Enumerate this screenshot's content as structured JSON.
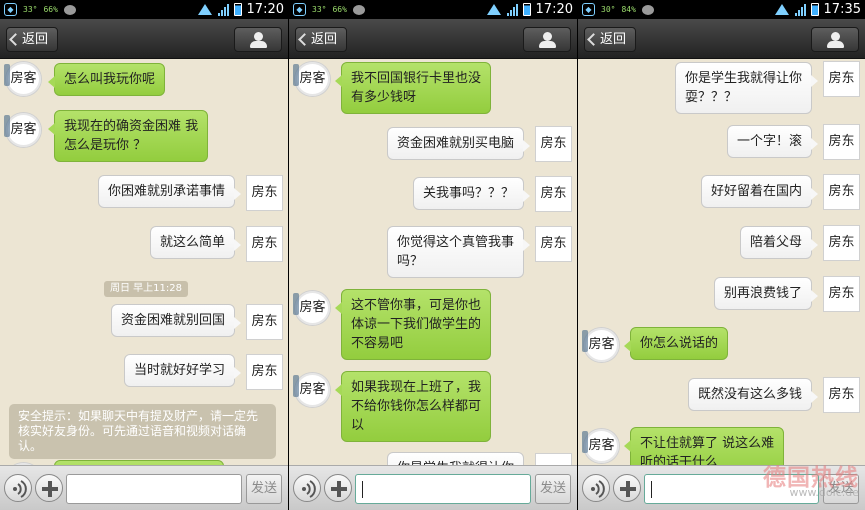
{
  "common": {
    "back_label": "返回",
    "guest_name": "房客",
    "host_name": "房东",
    "send_label": "发送"
  },
  "panels": [
    {
      "status": {
        "time": "17:20",
        "left_a": "33°",
        "left_b": "66%"
      },
      "messages": [
        {
          "side": "left",
          "text": "怎么叫我玩你呢"
        },
        {
          "side": "left",
          "text": "我现在的确资金困难 我\n怎么是玩你 ？"
        },
        {
          "side": "right",
          "text": "你困难就别承诺事情"
        },
        {
          "side": "right",
          "text": "就这么简单"
        },
        {
          "side": "time",
          "text": "周日 早上11:28"
        },
        {
          "side": "right",
          "text": "资金困难就别回国"
        },
        {
          "side": "right",
          "text": "当时就好好学习"
        },
        {
          "side": "notice",
          "text": "安全提示：如果聊天中有提及财产，请一定先核实好友身份。可先通过语音和视频对话确认。"
        }
      ]
    },
    {
      "status": {
        "time": "17:20",
        "left_a": "33°",
        "left_b": "66%"
      },
      "messages": [
        {
          "side": "left",
          "text": "我不回国银行卡里也没\n有多少钱呀"
        },
        {
          "side": "right",
          "text": "资金困难就别买电脑"
        },
        {
          "side": "right",
          "text": "关我事吗？？？"
        },
        {
          "side": "right",
          "text": "你觉得这个真管我事\n吗？"
        },
        {
          "side": "left",
          "text": "这不管你事，可是你也\n体谅一下我们做学生的\n不容易吧"
        },
        {
          "side": "left",
          "text": "如果我现在上班了，我\n不给你钱你怎么样都可\n以"
        },
        {
          "side": "right",
          "text": "你是学生我就得让你"
        }
      ]
    },
    {
      "status": {
        "time": "17:35",
        "left_a": "30°",
        "left_b": "84%"
      },
      "messages": [
        {
          "side": "right",
          "text": "你是学生我就得让你\n耍？？？"
        },
        {
          "side": "right",
          "text": "一个字！滚"
        },
        {
          "side": "right",
          "text": "好好留着在国内"
        },
        {
          "side": "right",
          "text": "陪着父母"
        },
        {
          "side": "right",
          "text": "别再浪费钱了"
        },
        {
          "side": "left",
          "text": "你怎么说话的"
        },
        {
          "side": "right",
          "text": "既然没有这么多钱"
        },
        {
          "side": "left",
          "text": "不让住就算了 说这么难\n听的话干什么"
        }
      ]
    }
  ],
  "watermark": {
    "main": "德国热线",
    "sub": "www.dolc.de"
  }
}
